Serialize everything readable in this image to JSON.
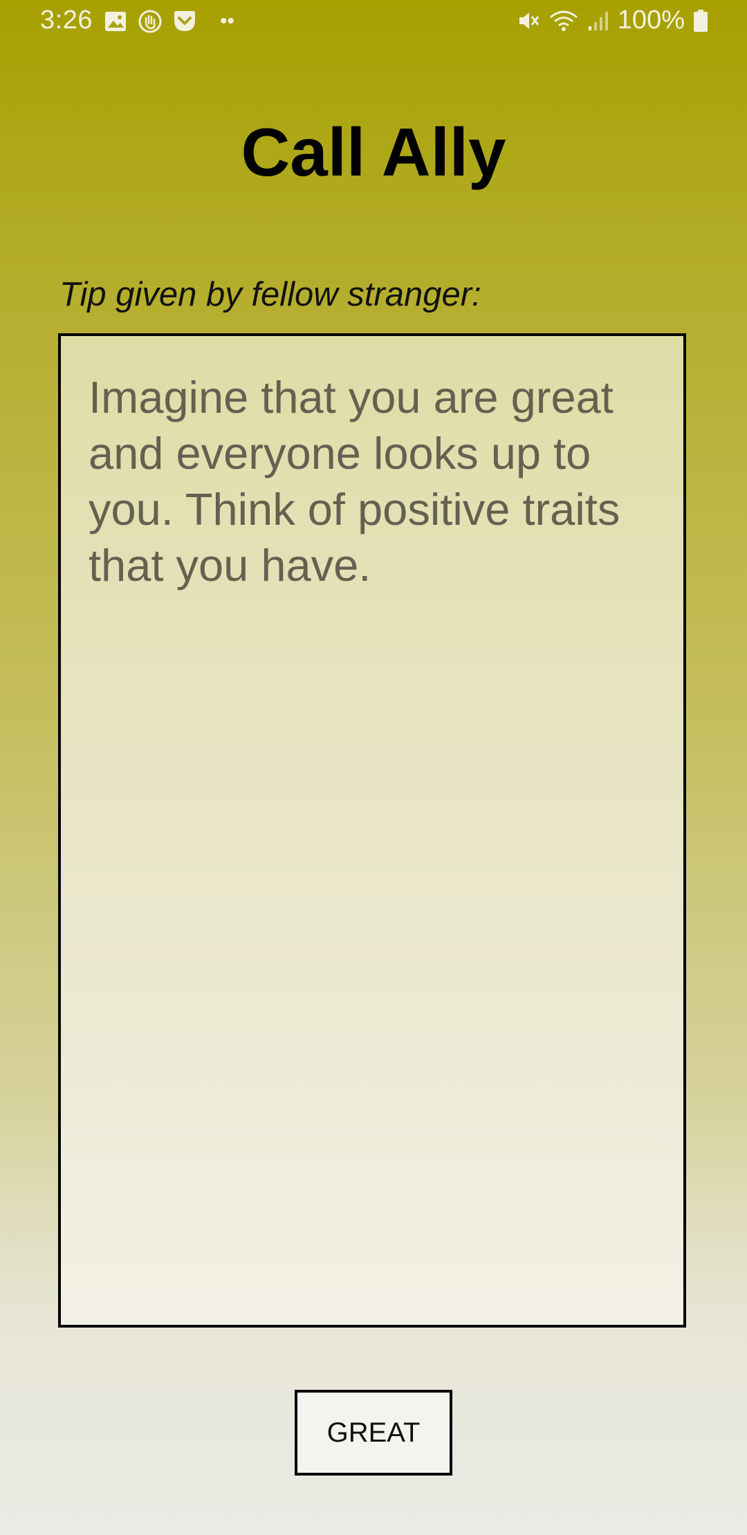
{
  "status_bar": {
    "time": "3:26",
    "left_icons": [
      "gallery-icon",
      "hand-icon",
      "pocket-icon"
    ],
    "more_indicator": "••",
    "right_icons": [
      "mute-icon",
      "wifi-icon",
      "signal-icon"
    ],
    "battery_percent": "100%"
  },
  "page": {
    "title": "Call Ally",
    "tip_label": "Tip given by fellow stranger:",
    "tip_text": "Imagine that you are great and everyone looks up to you. Think of positive traits that you have.",
    "button_label": "GREAT"
  },
  "colors": {
    "background_top": "#a7a000",
    "background_bottom": "#ebebe6",
    "tip_text": "#646150",
    "status_icons": "#f3f1dd"
  }
}
